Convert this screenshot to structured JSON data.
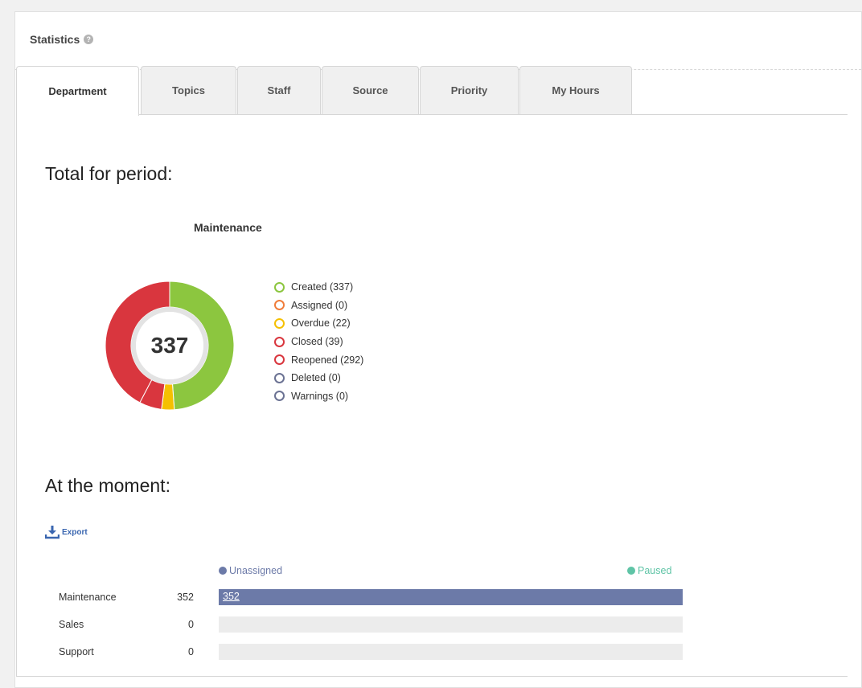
{
  "panel": {
    "title": "Statistics",
    "help_icon": "question-circle-icon"
  },
  "tabs": [
    {
      "label": "Department",
      "active": true
    },
    {
      "label": "Topics",
      "active": false
    },
    {
      "label": "Staff",
      "active": false
    },
    {
      "label": "Source",
      "active": false
    },
    {
      "label": "Priority",
      "active": false
    },
    {
      "label": "My Hours",
      "active": false
    }
  ],
  "period": {
    "heading": "Total for period:",
    "chart_title": "Maintenance",
    "center_value": "337",
    "legend": [
      {
        "label": "Created (337)",
        "color": "#8cc63f"
      },
      {
        "label": "Assigned (0)",
        "color": "#f07c3a"
      },
      {
        "label": "Overdue (22)",
        "color": "#f5c000"
      },
      {
        "label": "Closed (39)",
        "color": "#d9363e"
      },
      {
        "label": "Reopened (292)",
        "color": "#d9363e"
      },
      {
        "label": "Deleted (0)",
        "color": "#6b7293"
      },
      {
        "label": "Warnings (0)",
        "color": "#6b7293"
      }
    ]
  },
  "moment": {
    "heading": "At the moment:",
    "export_label": "Export",
    "legend": {
      "unassigned": "Unassigned",
      "paused": "Paused"
    },
    "colors": {
      "unassigned": "#6c7aa8",
      "paused": "#5fc4a6",
      "track": "#ececec"
    },
    "rows": [
      {
        "label": "Maintenance",
        "count": "352",
        "bar_label": "352",
        "fill_fraction": 1.0
      },
      {
        "label": "Sales",
        "count": "0",
        "bar_label": "",
        "fill_fraction": 0
      },
      {
        "label": "Support",
        "count": "0",
        "bar_label": "",
        "fill_fraction": 0
      }
    ]
  },
  "chart_data": {
    "type": "pie",
    "title": "Maintenance",
    "center_label": "337",
    "categories": [
      "Created",
      "Assigned",
      "Overdue",
      "Closed",
      "Reopened",
      "Deleted",
      "Warnings"
    ],
    "values": [
      337,
      0,
      22,
      39,
      292,
      0,
      0
    ],
    "colors": [
      "#8cc63f",
      "#f07c3a",
      "#f5c000",
      "#d9363e",
      "#d9363e",
      "#6b7293",
      "#6b7293"
    ],
    "legend_position": "right"
  }
}
